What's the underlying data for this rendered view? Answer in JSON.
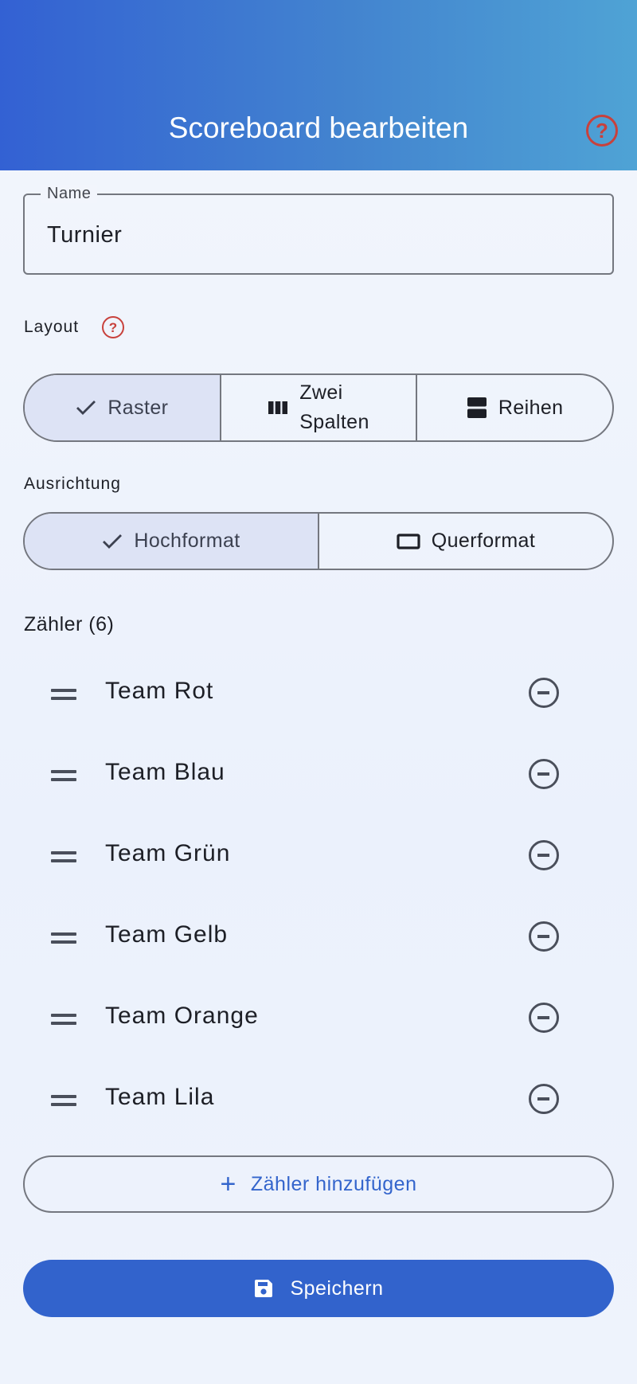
{
  "header": {
    "title": "Scoreboard bearbeiten",
    "help_icon": "?"
  },
  "name_field": {
    "label": "Name",
    "value": "Turnier"
  },
  "layout": {
    "label": "Layout",
    "help_icon": "?",
    "options": [
      {
        "label": "Raster",
        "icon": "check-icon",
        "selected": true
      },
      {
        "label": "Zwei Spalten",
        "line1": "Zwei",
        "line2": "Spalten",
        "icon": "columns-icon",
        "selected": false
      },
      {
        "label": "Reihen",
        "icon": "rows-icon",
        "selected": false
      }
    ]
  },
  "orientation": {
    "label": "Ausrichtung",
    "options": [
      {
        "label": "Hochformat",
        "icon": "check-icon",
        "selected": true
      },
      {
        "label": "Querformat",
        "icon": "landscape-icon",
        "selected": false
      }
    ]
  },
  "counters": {
    "title": "Zähler (6)",
    "items": [
      {
        "name": "Team Rot"
      },
      {
        "name": "Team Blau"
      },
      {
        "name": "Team Grün"
      },
      {
        "name": "Team Gelb"
      },
      {
        "name": "Team Orange"
      },
      {
        "name": "Team Lila"
      }
    ]
  },
  "actions": {
    "add_icon": "+",
    "add_label": "Zähler hinzufügen",
    "save_label": "Speichern"
  },
  "colors": {
    "header_gradient_start": "#3361d3",
    "header_gradient_end": "#4fa3d5",
    "accent": "#3263cc",
    "help_icon": "#c8413c",
    "selected_segment": "#dde3f5"
  }
}
